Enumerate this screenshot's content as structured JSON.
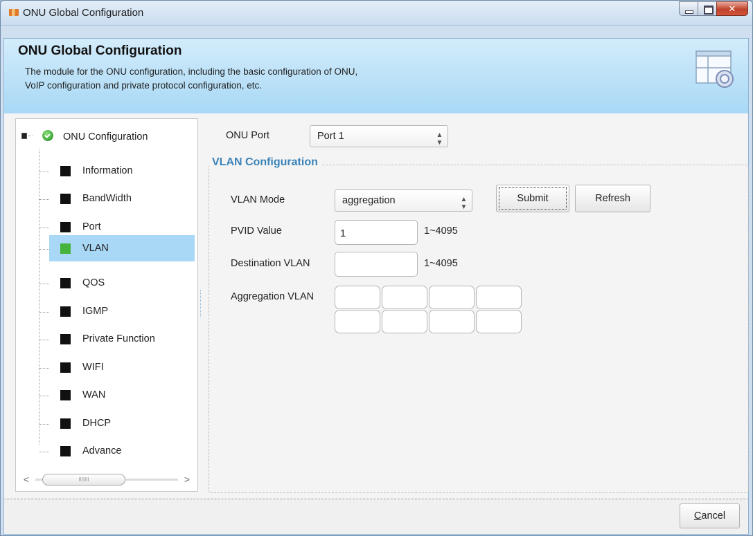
{
  "window": {
    "title": "ONU Global Configuration"
  },
  "banner": {
    "title": "ONU Global Configuration",
    "description_line1": "The module for the ONU configuration, including the basic configuration of ONU,",
    "description_line2": "VoIP configuration and private protocol configuration, etc."
  },
  "tree": {
    "root_label": "ONU Configuration",
    "items": [
      {
        "label": "Information",
        "selected": false
      },
      {
        "label": "BandWidth",
        "selected": false
      },
      {
        "label": "Port",
        "selected": false
      },
      {
        "label": "VLAN",
        "selected": true
      },
      {
        "label": "QOS",
        "selected": false
      },
      {
        "label": "IGMP",
        "selected": false
      },
      {
        "label": "Private Function",
        "selected": false
      },
      {
        "label": "WIFI",
        "selected": false
      },
      {
        "label": "WAN",
        "selected": false
      },
      {
        "label": "DHCP",
        "selected": false
      },
      {
        "label": "Advance",
        "selected": false
      }
    ],
    "scroll_left": "<",
    "scroll_right": ">",
    "scroll_grip": "IIIIIII"
  },
  "form": {
    "onu_port_label": "ONU Port",
    "onu_port_value": "Port 1",
    "group_title": "VLAN Configuration",
    "vlan_mode_label": "VLAN Mode",
    "vlan_mode_value": "aggregation",
    "submit_label": "Submit",
    "refresh_label": "Refresh",
    "pvid_label": "PVID Value",
    "pvid_value": "1",
    "pvid_range": "1~4095",
    "dest_vlan_label": "Destination VLAN",
    "dest_vlan_value": "",
    "dest_vlan_range": "1~4095",
    "agg_vlan_label": "Aggregation VLAN",
    "spin_glyph": "▲▼"
  },
  "footer": {
    "cancel_label_first": "C",
    "cancel_label_rest": "ancel"
  },
  "colors": {
    "selected_row": "#a8d8f5",
    "group_title": "#3b83b8",
    "selected_square": "#45b33c"
  }
}
